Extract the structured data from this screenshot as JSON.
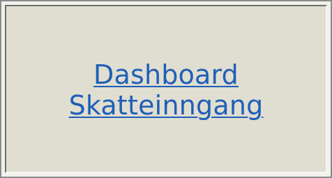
{
  "link": {
    "line1": "Dashboard",
    "line2": "Skatteinngang"
  },
  "colors": {
    "link": "#1f5fb8",
    "panel_background": "#e0ded1"
  }
}
